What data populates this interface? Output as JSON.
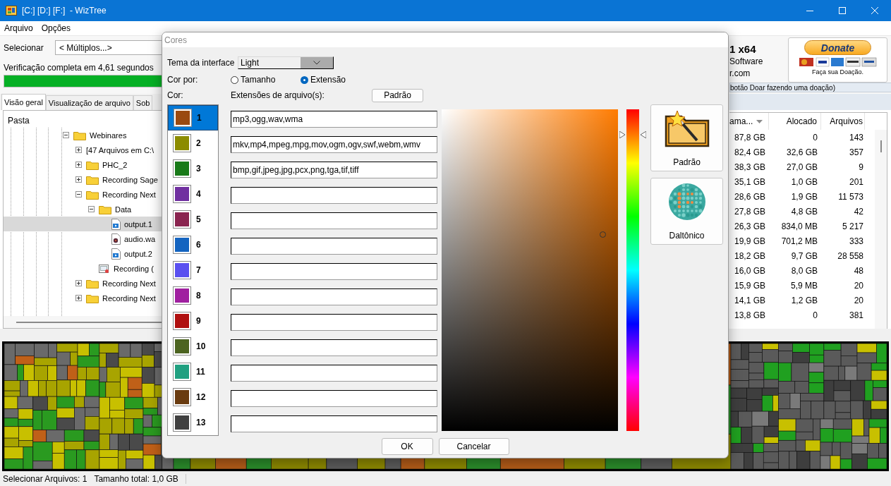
{
  "window": {
    "title": "[C:] [D:] [F:]  - WizTree"
  },
  "menu": [
    {
      "label": "Arquivo"
    },
    {
      "label": "Opções"
    }
  ],
  "toolbar": {
    "select_label": "Selecionar",
    "drive_select": "< Múltiplos...>",
    "scan_status": "Verificação completa em 4,61 segundos",
    "scan_progress": {
      "level": 1
    }
  },
  "about": {
    "version": "1 x64",
    "company": "Software",
    "website": "r.com",
    "donate_button": {
      "label": "Donate",
      "caption": "Faça sua Doação."
    },
    "donate_note": "botão Doar fazendo uma doação)"
  },
  "tabs": [
    {
      "label": "Visão geral",
      "selected": true
    },
    {
      "label": "Visualização de arquivo",
      "selected": false
    },
    {
      "label": "Sob",
      "selected": false
    }
  ],
  "tree": {
    "column": "Pasta",
    "items": [
      {
        "label": "Webinares",
        "kind": "folder",
        "expanded": true,
        "selected": false,
        "children": [
          {
            "label": "[47 Arquivos em C:\\",
            "kind": "files",
            "expanded": false,
            "selected": false
          },
          {
            "label": "PHC_2",
            "kind": "folder",
            "expanded": false,
            "selected": false
          },
          {
            "label": "Recording Sage",
            "kind": "folder",
            "expanded": false,
            "selected": false
          },
          {
            "label": "Recording Next",
            "kind": "folder",
            "expanded": true,
            "selected": false,
            "children": [
              {
                "label": "Data",
                "kind": "folder",
                "expanded": true,
                "selected": false,
                "children": [
                  {
                    "label": "output.1",
                    "kind": "video",
                    "selected": true
                  },
                  {
                    "label": "audio.wa",
                    "kind": "audio",
                    "selected": false
                  },
                  {
                    "label": "output.2",
                    "kind": "video",
                    "selected": false
                  }
                ]
              },
              {
                "label": "Recording (",
                "kind": "document",
                "selected": false
              }
            ]
          },
          {
            "label": "Recording Next",
            "kind": "folder",
            "expanded": false,
            "selected": false
          },
          {
            "label": "Recording Next",
            "kind": "folder",
            "expanded": false,
            "selected": false
          }
        ]
      }
    ]
  },
  "table": {
    "columns": [
      {
        "label": "ama...",
        "sorted": true
      },
      {
        "label": "Alocado",
        "sorted": false
      },
      {
        "label": "Arquivos",
        "sorted": false
      }
    ],
    "rows": [
      [
        "87,8 GB",
        "0",
        "143"
      ],
      [
        "82,4 GB",
        "32,6 GB",
        "357"
      ],
      [
        "38,3 GB",
        "27,0 GB",
        "9"
      ],
      [
        "35,1 GB",
        "1,0 GB",
        "201"
      ],
      [
        "28,6 GB",
        "1,9 GB",
        "11 573"
      ],
      [
        "27,8 GB",
        "4,8 GB",
        "42"
      ],
      [
        "26,3 GB",
        "834,0 MB",
        "5 217"
      ],
      [
        "19,9 GB",
        "701,2 MB",
        "333"
      ],
      [
        "18,2 GB",
        "9,7 GB",
        "28 558"
      ],
      [
        "16,0 GB",
        "8,0 GB",
        "48"
      ],
      [
        "15,9 GB",
        "5,9 MB",
        "20"
      ],
      [
        "14,1 GB",
        "1,2 GB",
        "20"
      ],
      [
        "13,8 GB",
        "0",
        "381"
      ]
    ]
  },
  "status_bar": [
    "Selecionar Arquivos: 1",
    "Tamanho total: 1,0 GB"
  ],
  "dialog": {
    "title": "Cores",
    "theme_label": "Tema da interface",
    "theme_select": "Light",
    "color_by_label": "Cor por:",
    "color_by": [
      {
        "label": "Tamanho",
        "selected": false
      },
      {
        "label": "Extensão",
        "selected": true
      }
    ],
    "colors_label": "Cor:",
    "extensions_label": "Extensões de arquivo(s):",
    "default_button": "Padrão",
    "colors": [
      {
        "number": "1",
        "color": "#9a4a10",
        "selected": true,
        "extensions": "mp3,ogg,wav,wma"
      },
      {
        "number": "2",
        "color": "#8c8c00",
        "selected": false,
        "extensions": "mkv,mp4,mpeg,mpg,mov,ogm,ogv,swf,webm,wmv"
      },
      {
        "number": "3",
        "color": "#197a19",
        "selected": false,
        "extensions": "bmp,gif,jpeg,jpg,pcx,png,tga,tif,tiff"
      },
      {
        "number": "4",
        "color": "#7030a0",
        "selected": false
      },
      {
        "number": "5",
        "color": "#8a2450",
        "selected": false
      },
      {
        "number": "6",
        "color": "#1464c0",
        "selected": false
      },
      {
        "number": "7",
        "color": "#5a50f0",
        "selected": false
      },
      {
        "number": "8",
        "color": "#a020a0",
        "selected": false
      },
      {
        "number": "9",
        "color": "#b01010",
        "selected": false
      },
      {
        "number": "10",
        "color": "#4c6420",
        "selected": false
      },
      {
        "number": "11",
        "color": "#20a080",
        "selected": false
      },
      {
        "number": "12",
        "color": "#6a3c10",
        "selected": false
      },
      {
        "number": "13",
        "color": "#404040",
        "selected": false
      }
    ],
    "hue_slider": {
      "level": 0.92
    },
    "presets": [
      {
        "label": "Padrão",
        "kind": "wand"
      },
      {
        "label": "Daltônico",
        "kind": "colorblind"
      }
    ],
    "buttons": [
      {
        "label": "OK"
      },
      {
        "label": "Cancelar"
      }
    ]
  }
}
